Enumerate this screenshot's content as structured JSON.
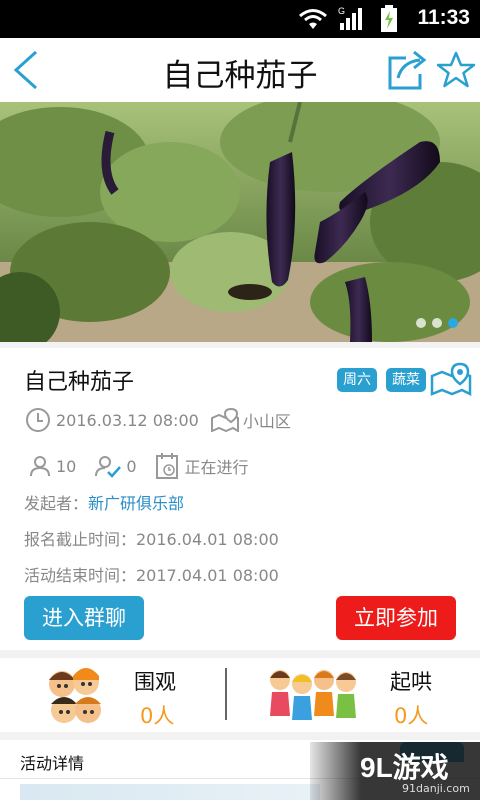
{
  "status_bar": {
    "time": "11:33",
    "signal_label": "G"
  },
  "header": {
    "title": "自己种茄子",
    "back_icon": "back-arrow-icon",
    "share_icon": "share-icon",
    "favorite_icon": "star-icon"
  },
  "hero": {
    "carousel_count": 3,
    "active_index": 3
  },
  "event": {
    "name": "自己种茄子",
    "tags": [
      "周六",
      "蔬菜"
    ],
    "datetime": "2016.03.12 08:00",
    "location": "小山区",
    "participants": "10",
    "checked_in": "0",
    "status": "正在进行",
    "organizer_label": "发起者：",
    "organizer": "新广研俱乐部",
    "signup_deadline": "报名截止时间：2016.04.01 08:00",
    "end_time": "活动结束时间：2017.04.01 08:00",
    "chat_button": "进入群聊",
    "join_button": "立即参加"
  },
  "stats": {
    "watch_label": "围观",
    "watch_value": "0人",
    "cheer_label": "起哄",
    "cheer_value": "0人"
  },
  "details": {
    "header": "活动详情"
  },
  "watermark": {
    "brand": "9L游戏",
    "url": "91danji.com"
  },
  "colors": {
    "accent": "#2aa0d0",
    "join": "#ee1b1b",
    "count": "#f39a1e"
  }
}
